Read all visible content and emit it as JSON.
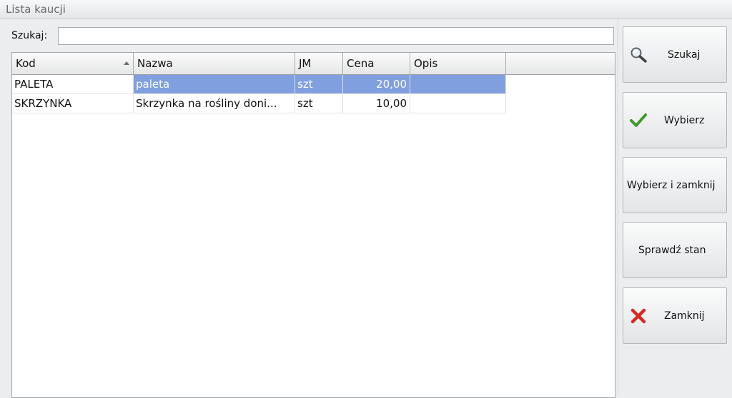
{
  "window": {
    "title": "Lista kaucji"
  },
  "search": {
    "label": "Szukaj:",
    "value": "",
    "placeholder": ""
  },
  "table": {
    "columns": [
      "Kod",
      "Nazwa",
      "JM",
      "Cena",
      "Opis"
    ],
    "sorted_column": "Kod",
    "rows": [
      {
        "kod": "PALETA",
        "nazwa": "paleta",
        "jm": "szt",
        "cena": "20,00",
        "opis": ""
      },
      {
        "kod": "SKRZYNKA",
        "nazwa": "Skrzynka na rośliny doni...",
        "jm": "szt",
        "cena": "10,00",
        "opis": ""
      }
    ],
    "selected_row": 0,
    "selection_color": "#7f9fdf"
  },
  "buttons": {
    "szukaj": {
      "label": "Szukaj",
      "icon": "magnifier-icon"
    },
    "wybierz": {
      "label": "Wybierz",
      "icon": "green-check-icon"
    },
    "wybierz_zamknij": {
      "label": "Wybierz i zamknij"
    },
    "sprawdz_stan": {
      "label": "Sprawdź stan"
    },
    "zamknij": {
      "label": "Zamknij",
      "icon": "red-x-icon"
    }
  }
}
